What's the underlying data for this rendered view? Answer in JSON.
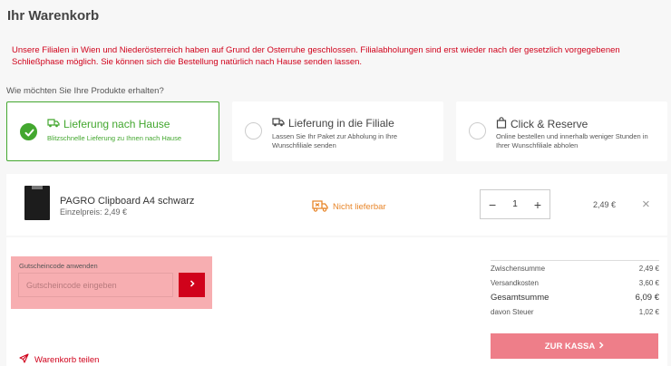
{
  "page": {
    "title": "Ihr Warenkorb"
  },
  "notice": {
    "text": "Unsere Filialen in Wien und Niederösterreich haben auf Grund der Osterruhe geschlossen. Filialabholungen sind erst wieder nach der gesetzlich vorgegebenen Schließphase möglich. Sie können sich die Bestellung natürlich nach Hause senden lassen."
  },
  "delivery": {
    "question": "Wie möchten Sie Ihre Produkte erhalten?",
    "options": [
      {
        "title": "Lieferung nach Hause",
        "subtitle": "Blitzschnelle Lieferung zu Ihnen nach Hause",
        "icon": "truck-icon",
        "selected": true
      },
      {
        "title": "Lieferung in die Filiale",
        "subtitle": "Lassen Sie Ihr Paket zur Abholung in Ihre Wunschfiliale senden",
        "icon": "truck-icon",
        "selected": false
      },
      {
        "title": "Click & Reserve",
        "subtitle": "Online bestellen und innerhalb weniger Stunden in Ihrer Wunschfiliale abholen",
        "icon": "shopping-bag-icon",
        "selected": false
      }
    ]
  },
  "cart": {
    "items": [
      {
        "name": "PAGRO Clipboard A4 schwarz",
        "unit_price": "Einzelpreis: 2,49 €",
        "availability": "Nicht lieferbar",
        "quantity": "1",
        "total": "2,49 €"
      }
    ]
  },
  "voucher": {
    "label": "Gutscheincode anwenden",
    "placeholder": "Gutscheincode eingeben",
    "button_icon": "chevron-right-icon"
  },
  "share": {
    "label": "Warenkorb teilen",
    "icon": "paper-plane-icon"
  },
  "summary": {
    "rows": [
      {
        "label": "Zwischensumme",
        "value": "2,49 €"
      },
      {
        "label": "Versandkosten",
        "value": "3,60 €"
      },
      {
        "label": "Gesamtsumme",
        "value": "6,09 €"
      },
      {
        "label": "davon Steuer",
        "value": "1,02 €"
      }
    ],
    "checkout_label": "ZUR KASSA"
  },
  "colors": {
    "brand_red": "#d0021b",
    "success_green": "#43a72f",
    "warning_orange": "#e8862a",
    "checkout_pink": "#ee7e89",
    "voucher_highlight": "#f7aeb1"
  }
}
